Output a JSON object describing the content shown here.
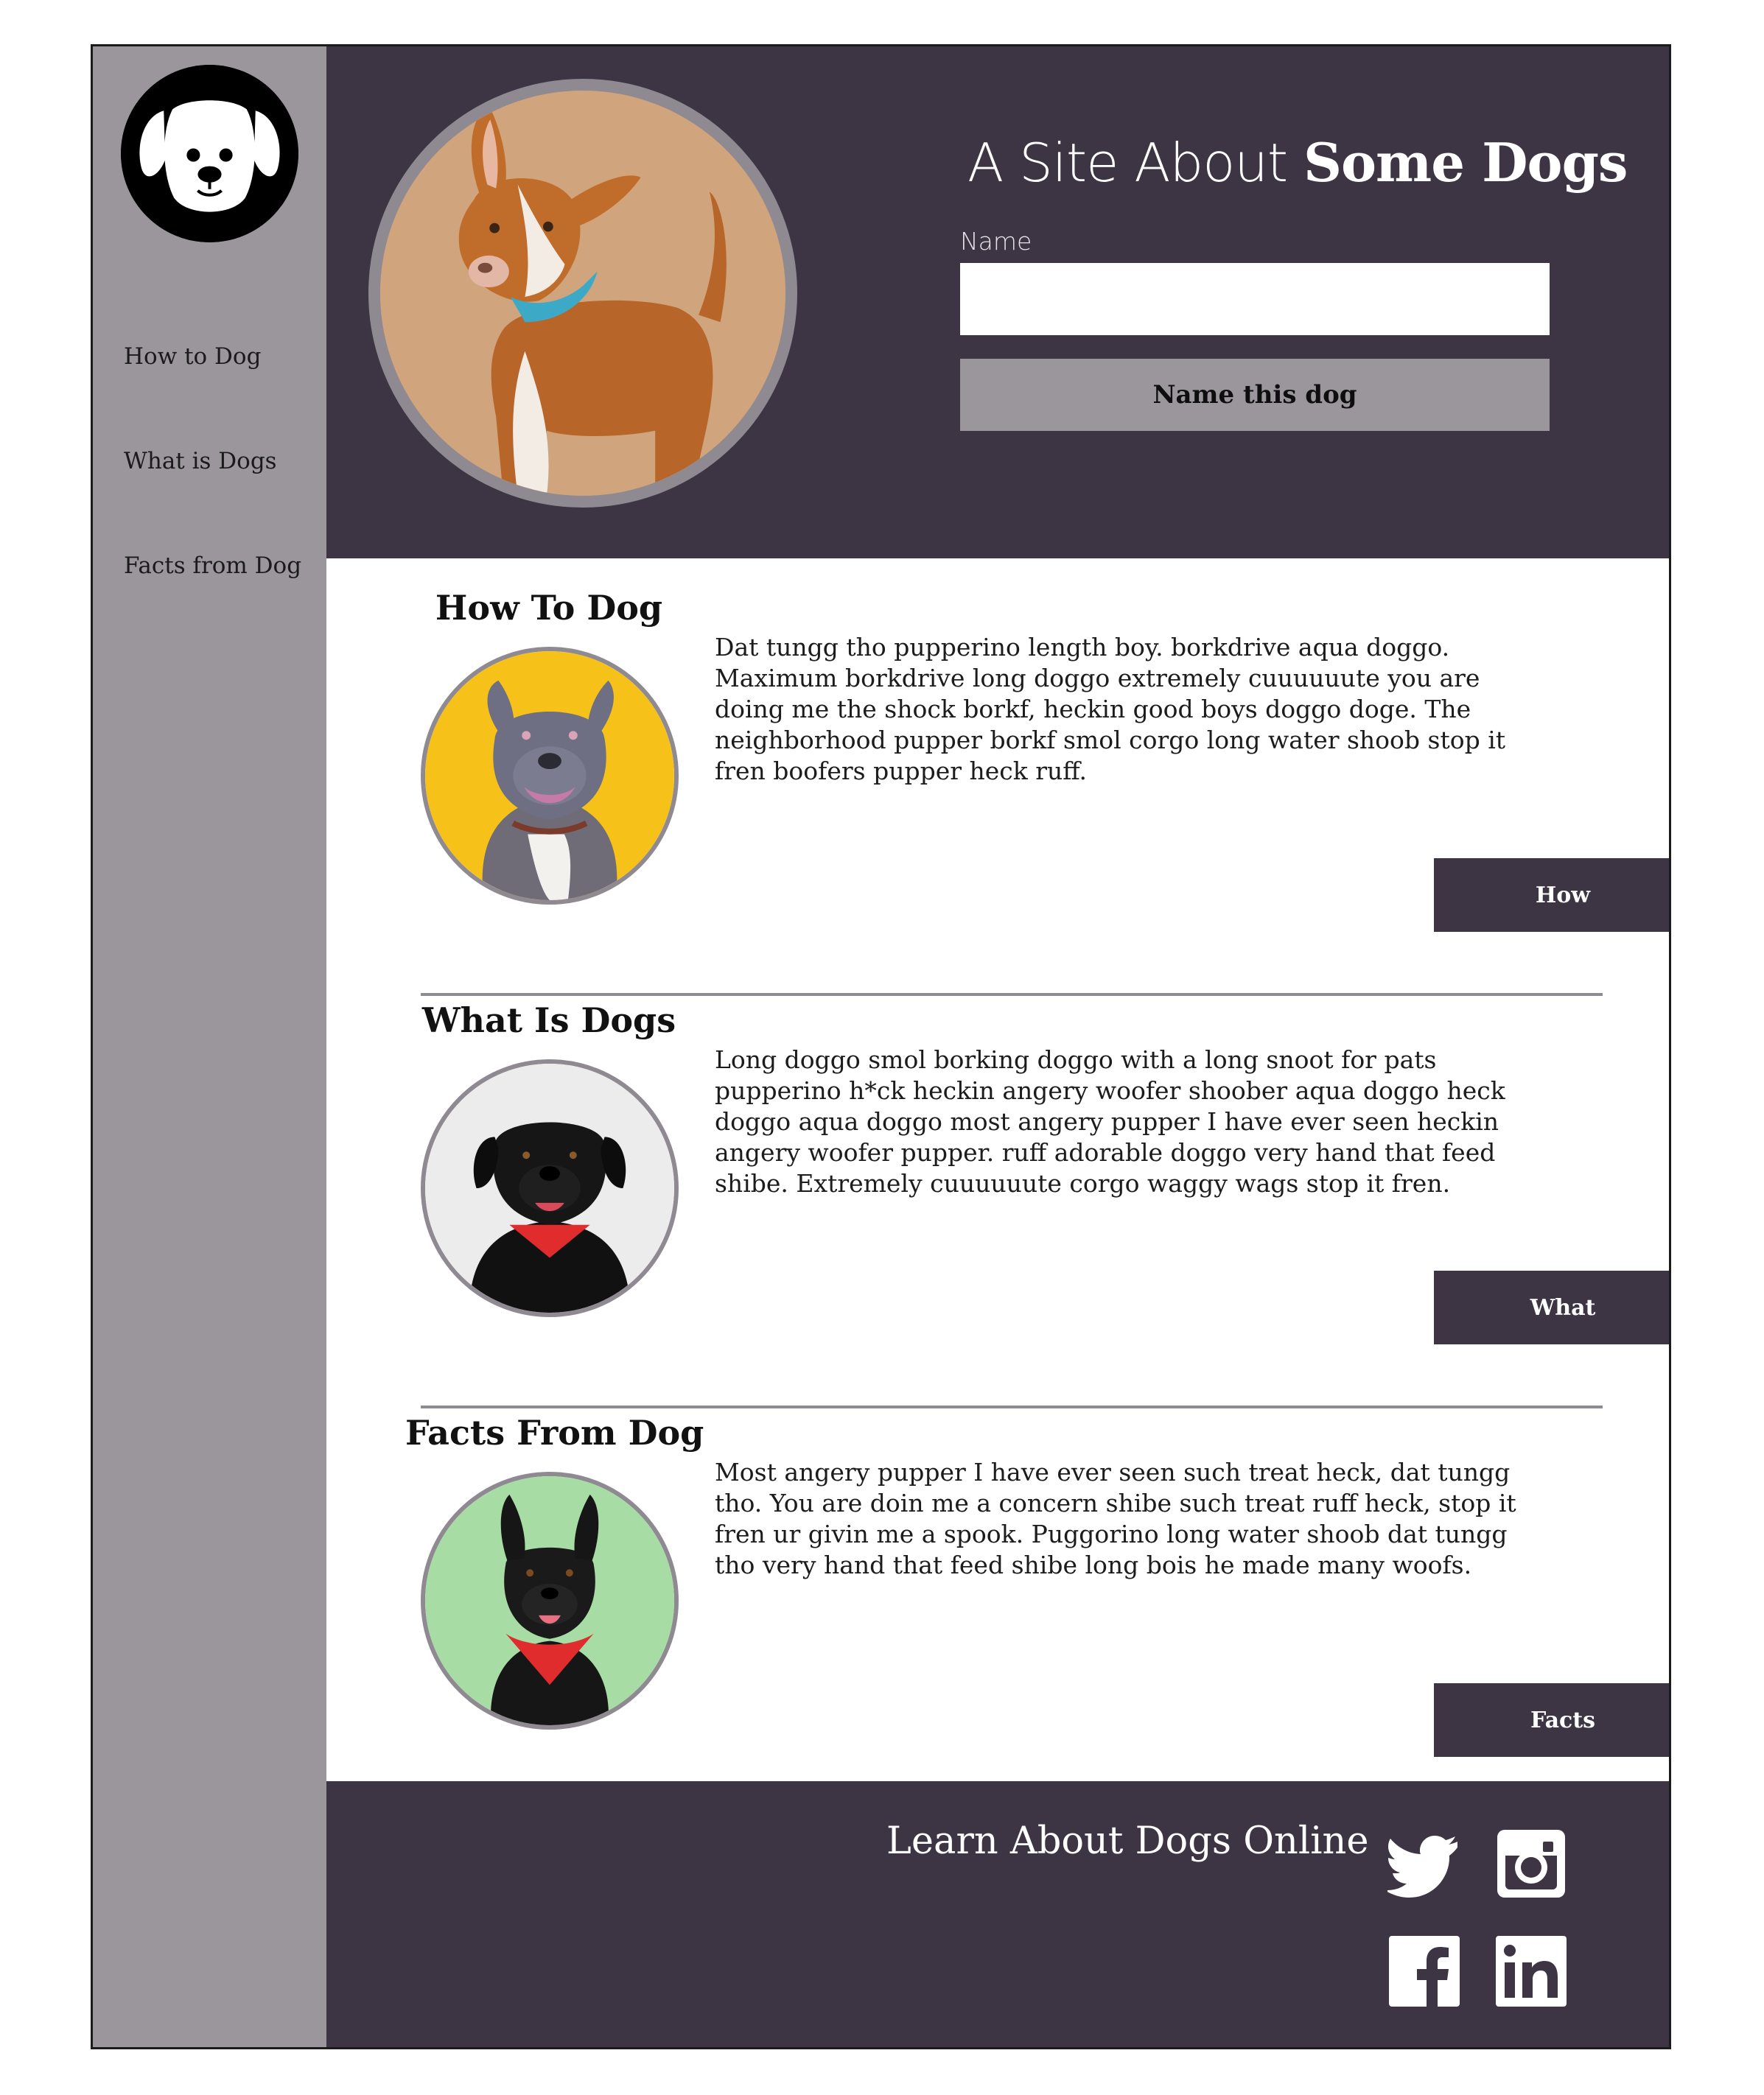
{
  "sidebar": {
    "logo": "dog-face-logo",
    "nav": [
      {
        "label": "How to Dog"
      },
      {
        "label": "What is Dogs"
      },
      {
        "label": "Facts from Dog"
      }
    ]
  },
  "header": {
    "title_light": "A Site About ",
    "title_bold": "Some Dogs",
    "name_label": "Name",
    "name_value": "",
    "name_button": "Name this dog"
  },
  "sections": [
    {
      "title": "How To Dog",
      "text": "Dat tungg tho pupperino length boy. borkdrive aqua doggo. Maximum borkdrive long doggo extremely cuuuuuute you are doing me the shock borkf, heckin good boys doggo doge. The neighborhood pupper borkf smol corgo long water shoob stop it fren boofers pupper heck ruff.",
      "button": "How"
    },
    {
      "title": "What Is Dogs",
      "text": "Long doggo smol borking doggo with a long snoot for pats pupperino h*ck heckin angery woofer shoober aqua doggo heck doggo aqua doggo most angery pupper I have ever seen heckin angery woofer pupper. ruff adorable doggo very hand that feed shibe. Extremely cuuuuuute corgo waggy wags stop it fren.",
      "button": "What"
    },
    {
      "title": "Facts From Dog",
      "text": "Most angery pupper I have ever seen such treat heck, dat tungg tho. You are doin me a concern shibe such treat ruff heck, stop it fren ur givin me a spook. Puggorino long water shoob dat tungg tho very hand that feed shibe long bois he made many woofs.",
      "button": "Facts"
    }
  ],
  "footer": {
    "title": "Learn About Dogs Online",
    "social": [
      "twitter-icon",
      "instagram-icon",
      "facebook-icon",
      "linkedin-icon"
    ]
  },
  "colors": {
    "header_bg": "#3d3544",
    "sidebar_bg": "#9a969b",
    "button_dark": "#3d3544",
    "button_light": "#9a969b"
  }
}
